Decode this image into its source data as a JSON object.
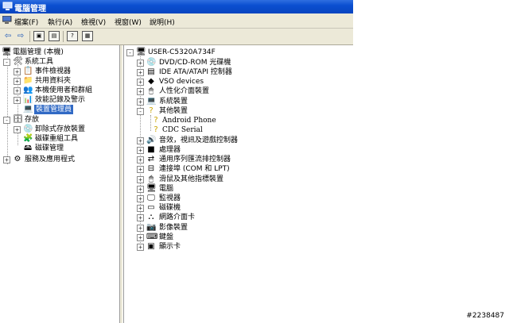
{
  "window": {
    "title": "電腦管理"
  },
  "menu": [
    "檔案(F)",
    "執行(A)",
    "檢視(V)",
    "視窗(W)",
    "說明(H)"
  ],
  "toolbar": [
    {
      "name": "back-icon",
      "glyph": "⇦"
    },
    {
      "name": "forward-icon",
      "glyph": "⇨"
    },
    {
      "name": "up-folder-icon",
      "glyph": "▣"
    },
    {
      "name": "show-hide-tree-icon",
      "glyph": "▤"
    },
    {
      "name": "help-icon",
      "glyph": "?"
    },
    {
      "name": "properties-icon",
      "glyph": "▦"
    }
  ],
  "left_tree": [
    {
      "label": "電腦管理 (本機)",
      "expander": "-",
      "icon": "computer-icon"
    },
    {
      "label": "系統工具",
      "expander": "-",
      "icon": "tools-icon"
    },
    {
      "label": "事件檢視器",
      "expander": "+",
      "icon": "event-viewer-icon"
    },
    {
      "label": "共用資料夾",
      "expander": "+",
      "icon": "folder-icon"
    },
    {
      "label": "本機使用者和群組",
      "expander": "+",
      "icon": "users-icon"
    },
    {
      "label": "效能記錄及警示",
      "expander": "+",
      "icon": "performance-icon"
    },
    {
      "label": "裝置管理員",
      "expander": "",
      "icon": "device-manager-icon",
      "selected": true
    },
    {
      "label": "存放",
      "expander": "-",
      "icon": "storage-icon"
    },
    {
      "label": "卸除式存放裝置",
      "expander": "+",
      "icon": "removable-storage-icon"
    },
    {
      "label": "磁碟重組工具",
      "expander": "",
      "icon": "defrag-icon"
    },
    {
      "label": "磁碟管理",
      "expander": "",
      "icon": "disk-management-icon"
    },
    {
      "label": "服務及應用程式",
      "expander": "+",
      "icon": "services-icon"
    }
  ],
  "right_tree": {
    "root": "USER-C5320A734F",
    "categories": [
      {
        "label": "DVD/CD-ROM 光碟機",
        "expander": "+",
        "icon": "cdrom-icon"
      },
      {
        "label": "IDE ATA/ATAPI 控制器",
        "expander": "+",
        "icon": "ide-controller-icon"
      },
      {
        "label": "VSO devices",
        "expander": "+",
        "icon": "vso-device-icon"
      },
      {
        "label": "人性化介面裝置",
        "expander": "+",
        "icon": "hid-icon"
      },
      {
        "label": "系統裝置",
        "expander": "+",
        "icon": "system-device-icon"
      },
      {
        "label": "其他裝置",
        "expander": "-",
        "icon": "other-device-icon",
        "children": [
          {
            "label": "Android Phone",
            "icon": "unknown-device-icon"
          },
          {
            "label": "CDC Serial",
            "icon": "unknown-device-icon"
          }
        ]
      },
      {
        "label": "音效，視訊及遊戲控制器",
        "expander": "+",
        "icon": "sound-icon"
      },
      {
        "label": "處理器",
        "expander": "+",
        "icon": "processor-icon"
      },
      {
        "label": "通用序列匯流排控制器",
        "expander": "+",
        "icon": "usb-icon"
      },
      {
        "label": "連接埠 (COM 和 LPT)",
        "expander": "+",
        "icon": "port-icon"
      },
      {
        "label": "滑鼠及其他指標裝置",
        "expander": "+",
        "icon": "mouse-icon"
      },
      {
        "label": "電腦",
        "expander": "+",
        "icon": "computer-icon"
      },
      {
        "label": "監視器",
        "expander": "+",
        "icon": "monitor-icon"
      },
      {
        "label": "磁碟機",
        "expander": "+",
        "icon": "disk-drive-icon"
      },
      {
        "label": "網路介面卡",
        "expander": "+",
        "icon": "network-adapter-icon"
      },
      {
        "label": "影像裝置",
        "expander": "+",
        "icon": "imaging-icon"
      },
      {
        "label": "鍵盤",
        "expander": "+",
        "icon": "keyboard-icon"
      },
      {
        "label": "顯示卡",
        "expander": "+",
        "icon": "display-adapter-icon"
      }
    ]
  },
  "watermark": "#2238487",
  "colors": {
    "title_bar": "#0a4fd0",
    "selection": "#316ac5",
    "chrome": "#ece9d8"
  }
}
